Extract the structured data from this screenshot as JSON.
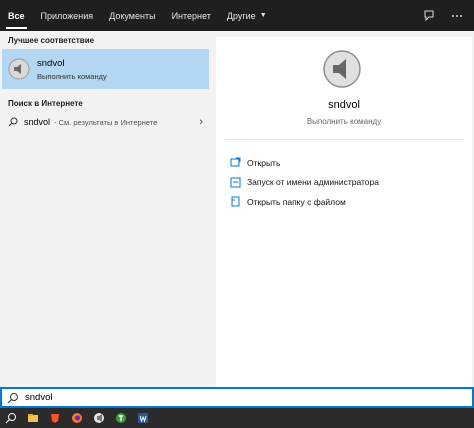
{
  "tabs": [
    {
      "label": "Все",
      "active": true
    },
    {
      "label": "Приложения"
    },
    {
      "label": "Документы"
    },
    {
      "label": "Интернет"
    },
    {
      "label": "Другие"
    }
  ],
  "top_icons": [
    "feedback-icon",
    "more-icon"
  ],
  "best_match": {
    "section": "Лучшее соответствие",
    "name": "sndvol",
    "subtitle": "Выполнить команду"
  },
  "web": {
    "section": "Поиск в Интернете",
    "query": "sndvol",
    "hint": "- См. результаты в Интернете"
  },
  "detail": {
    "name": "sndvol",
    "subtitle": "Выполнить команду",
    "actions": [
      {
        "label": "Открыть",
        "icon": "open-icon"
      },
      {
        "label": "Запуск от имени администратора",
        "icon": "shield-icon"
      },
      {
        "label": "Открыть папку с файлом",
        "icon": "file-icon"
      }
    ]
  },
  "search": {
    "value": "sndvol"
  },
  "taskbar": [
    "search-icon",
    "file-explorer-icon",
    "brave-icon",
    "firefox-icon",
    "media-icon",
    "torrent-icon",
    "word-icon"
  ],
  "colors": {
    "accent": "#0078d7",
    "selection": "#b3d7f2",
    "topbar": "#1f1f1f"
  }
}
